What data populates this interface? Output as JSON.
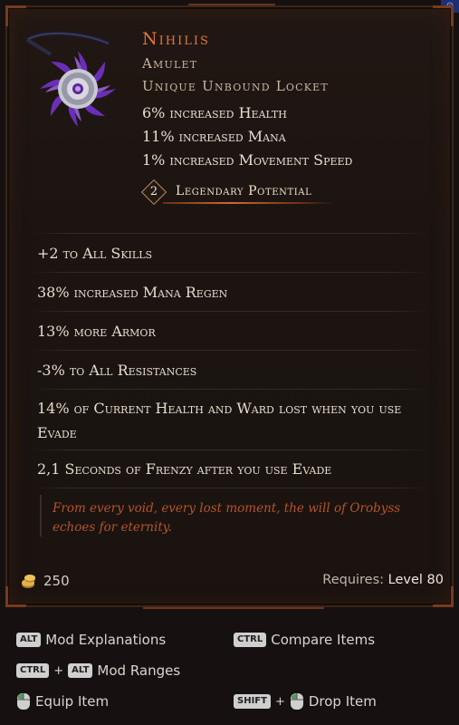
{
  "item": {
    "name": "Nihilis",
    "type": "Amulet",
    "subtype": "Unique Unbound Locket",
    "implicits": [
      "6% increased Health",
      "11% increased Mana",
      "1% increased Movement Speed"
    ],
    "legendary_potential": {
      "value": "2",
      "label": "Legendary Potential"
    },
    "affixes": [
      "+2 to All Skills",
      "38% increased Mana Regen",
      "13% more Armor",
      "-3% to All Resistances",
      "14% of Current Health and Ward lost when you use Evade",
      "2,1 Seconds of Frenzy after you use Evade"
    ],
    "lore": "From every void, every lost moment, the will of Orobyss echoes for eternity.",
    "price": "250",
    "requires_label": "Requires:",
    "requires_level": "Level 80"
  },
  "hints": {
    "mod_explanations": {
      "keys": [
        "ALT"
      ],
      "label": "Mod Explanations"
    },
    "compare_items": {
      "keys": [
        "CTRL"
      ],
      "label": "Compare Items"
    },
    "mod_ranges": {
      "keys": [
        "CTRL",
        "ALT"
      ],
      "label": "Mod Ranges"
    },
    "equip_item": {
      "label": "Equip Item"
    },
    "drop_item": {
      "keys": [
        "SHIFT"
      ],
      "label": "Drop Item"
    }
  },
  "colors": {
    "unique_name": "#e2763a",
    "lore": "#b5542a",
    "legendary_accent": "#d06a2e"
  },
  "icons": {
    "item": "amulet-icon",
    "currency": "gold-coin-icon",
    "mouse": "mouse-icon"
  }
}
